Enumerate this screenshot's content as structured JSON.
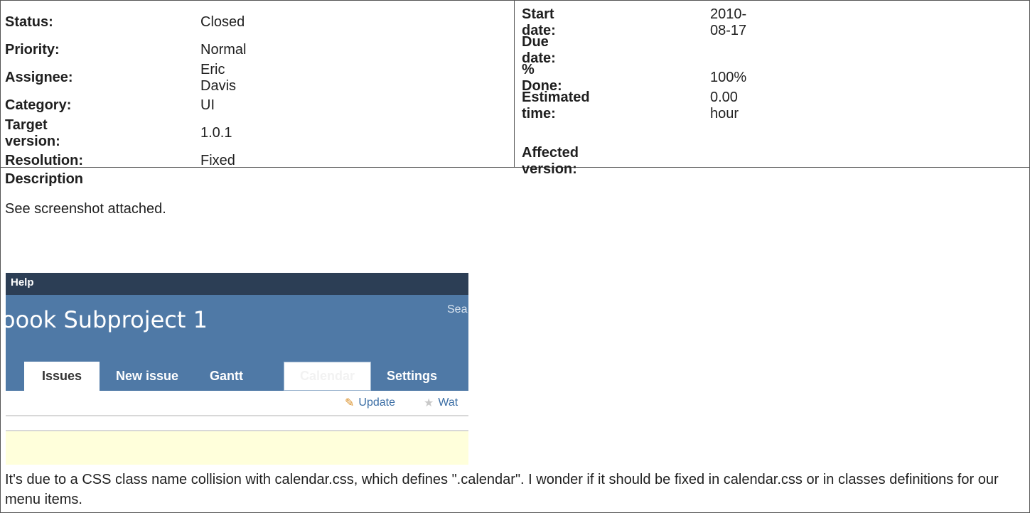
{
  "attributes_left": [
    {
      "label": "Status:",
      "value": "Closed"
    },
    {
      "label": "Priority:",
      "value": "Normal"
    },
    {
      "label": "Assignee:",
      "value": "Eric Davis"
    },
    {
      "label": "Category:",
      "value": "UI"
    },
    {
      "label": "Target version:",
      "value": "1.0.1"
    },
    {
      "label": "Resolution:",
      "value": "Fixed"
    }
  ],
  "attributes_right": [
    {
      "label": "Start date:",
      "value": "2010-08-17"
    },
    {
      "label": "Due date:",
      "value": ""
    },
    {
      "label": "% Done:",
      "value": "100%"
    },
    {
      "label": "Estimated time:",
      "value": "0.00 hour"
    },
    {
      "label": "",
      "value": ""
    },
    {
      "label": "Affected version:",
      "value": ""
    }
  ],
  "description": {
    "heading": "Description",
    "text": "See screenshot attached.",
    "footer": "It's due to a CSS class name collision with calendar.css, which defines \".calendar\". I wonder if it should be fixed in calendar.css or in classes definitions for our menu items."
  },
  "screenshot": {
    "top_menu": "Help",
    "project_title": "oook Subproject 1",
    "search_label": "Sea",
    "tabs": [
      "Issues",
      "New issue",
      "Gantt",
      "Calendar",
      "Settings"
    ],
    "actions": {
      "update": "Update",
      "watch": "Wat"
    },
    "icons": {
      "update": "pencil-icon",
      "watch": "star-icon"
    },
    "colors": {
      "top_bar": "#2c3e55",
      "header": "#4f79a6",
      "note": "#ffffdb",
      "link": "#3b6ea5"
    }
  }
}
